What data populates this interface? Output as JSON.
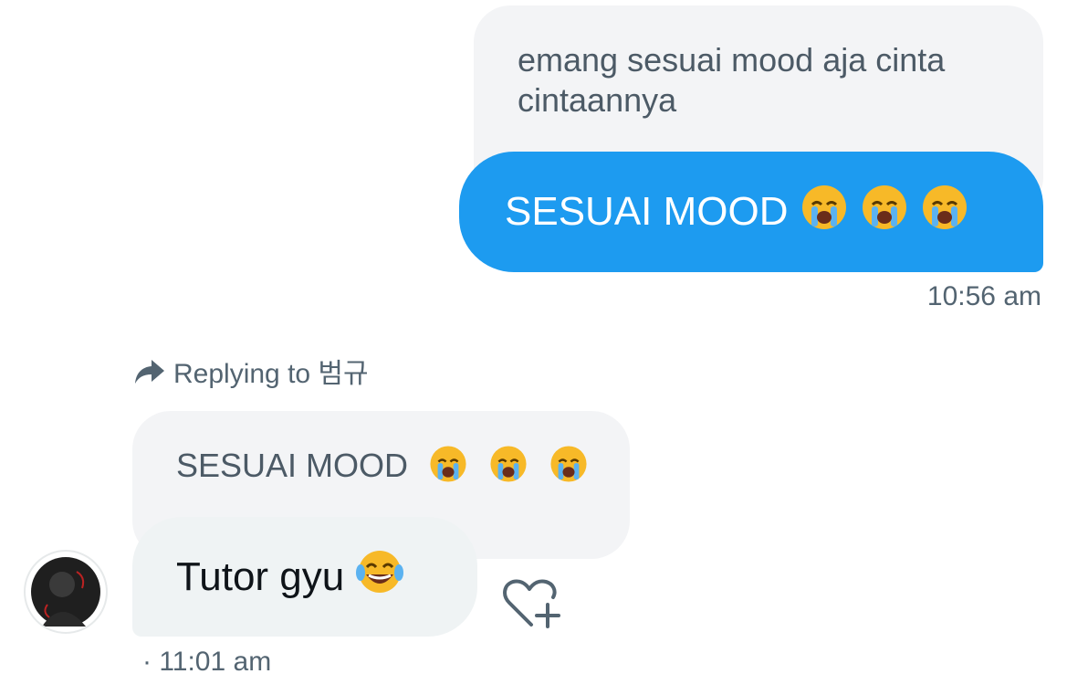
{
  "conversation": {
    "sent": {
      "quoted_text": "emang sesuai mood aja cinta cintaannya",
      "message_text": "SESUAI MOOD",
      "emojis": [
        "crying-face",
        "crying-face",
        "crying-face"
      ],
      "timestamp": "10:56 am"
    },
    "reply_context": {
      "label": "Replying to 범규",
      "icon": "reply-arrow-icon"
    },
    "received": {
      "quoted_text": "SESUAI MOOD",
      "quoted_emojis": [
        "crying-face",
        "crying-face",
        "crying-face"
      ],
      "message_text": "Tutor gyu",
      "emojis": [
        "tears-of-joy-face"
      ],
      "timestamp": "· 11:01 am",
      "react_icon": "heart-plus-icon"
    }
  },
  "colors": {
    "sent_bubble": "#1d9bf0",
    "received_bubble": "#eff3f4",
    "quoted_bubble": "#f3f4f6",
    "secondary_text": "#536471"
  }
}
